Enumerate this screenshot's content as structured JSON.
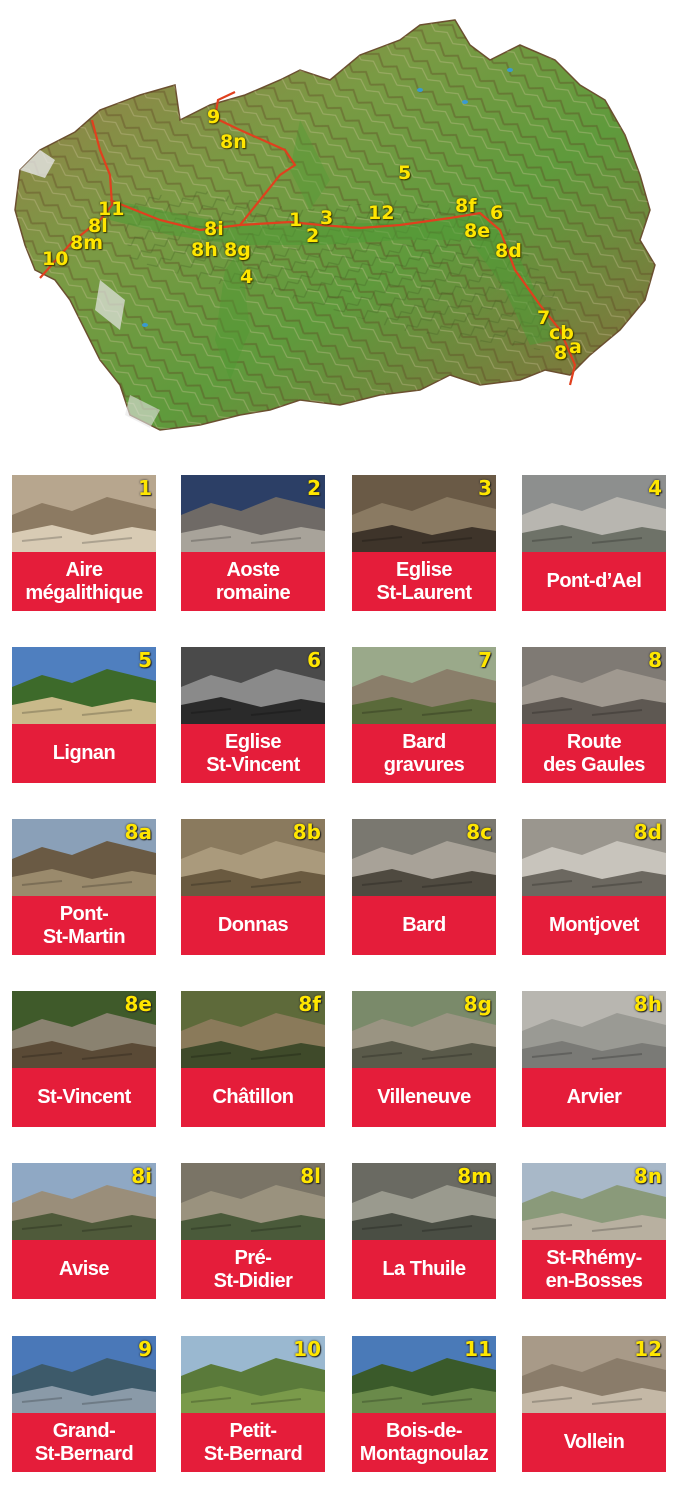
{
  "map": {
    "route_color": "#e0401e",
    "label_color": "#ffe600",
    "labels": [
      "9",
      "8n",
      "5",
      "11",
      "8l",
      "8m",
      "10",
      "8i",
      "8h",
      "8g",
      "4",
      "1",
      "3",
      "2",
      "12",
      "8f",
      "6",
      "8e",
      "8d",
      "7",
      "cb",
      "8",
      "a"
    ]
  },
  "sites": [
    {
      "num": "1",
      "name": "Aire\nmégalithique"
    },
    {
      "num": "2",
      "name": "Aoste\nromaine"
    },
    {
      "num": "3",
      "name": "Eglise\nSt-Laurent"
    },
    {
      "num": "4",
      "name": "Pont-d’Ael"
    },
    {
      "num": "5",
      "name": "Lignan"
    },
    {
      "num": "6",
      "name": "Eglise\nSt-Vincent"
    },
    {
      "num": "7",
      "name": "Bard\ngravures"
    },
    {
      "num": "8",
      "name": "Route\ndes Gaules"
    },
    {
      "num": "8a",
      "name": "Pont-\nSt-Martin"
    },
    {
      "num": "8b",
      "name": "Donnas"
    },
    {
      "num": "8c",
      "name": "Bard"
    },
    {
      "num": "8d",
      "name": "Montjovet"
    },
    {
      "num": "8e",
      "name": "St-Vincent"
    },
    {
      "num": "8f",
      "name": "Châtillon"
    },
    {
      "num": "8g",
      "name": "Villeneuve"
    },
    {
      "num": "8h",
      "name": "Arvier"
    },
    {
      "num": "8i",
      "name": "Avise"
    },
    {
      "num": "8l",
      "name": "Pré-\nSt-Didier"
    },
    {
      "num": "8m",
      "name": "La Thuile"
    },
    {
      "num": "8n",
      "name": "St-Rhémy-\nen-Bosses"
    },
    {
      "num": "9",
      "name": "Grand-\nSt-Bernard"
    },
    {
      "num": "10",
      "name": "Petit-\nSt-Bernard"
    },
    {
      "num": "11",
      "name": "Bois-de-\nMontagnoulaz"
    },
    {
      "num": "12",
      "name": "Vollein"
    }
  ],
  "colors": {
    "card_red": "#e51d3a",
    "badge_yellow": "#ffe600",
    "caption_white": "#ffffff"
  }
}
